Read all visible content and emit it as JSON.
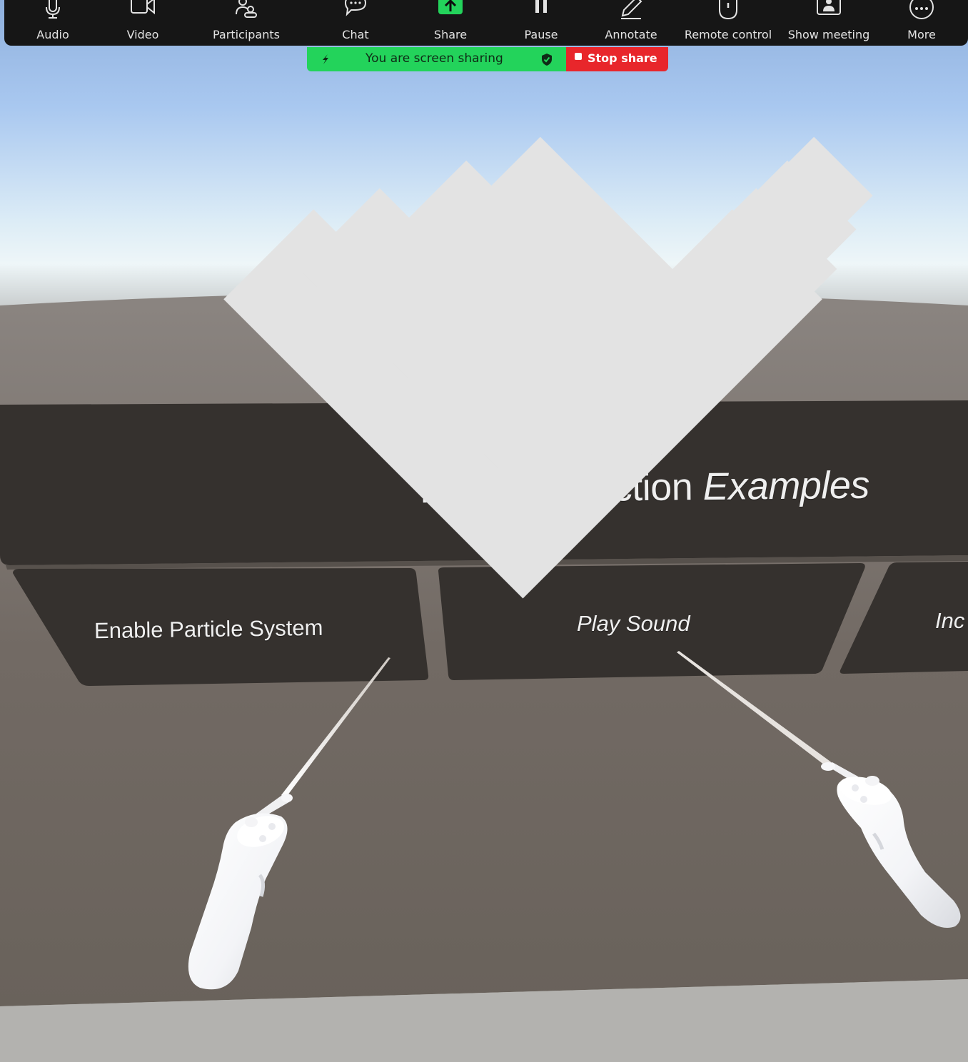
{
  "toolbar": {
    "audio_label": "Audio",
    "video_label": "Video",
    "participants_label": "Participants",
    "chat_label": "Chat",
    "share_label": "Share",
    "pause_label": "Pause",
    "annotate_label": "Annotate",
    "remote_control_label": "Remote control",
    "show_meeting_label": "Show meeting",
    "more_label": "More"
  },
  "share_banner": {
    "status_text": "You are screen sharing",
    "stop_label": "Stop share"
  },
  "vr_scene": {
    "panel_title_regular": "Poke Interaction ",
    "panel_title_italic": "Examples",
    "buttons": [
      {
        "label": "Enable Particle System"
      },
      {
        "label": "Play Sound"
      },
      {
        "label": "Inc"
      }
    ]
  },
  "colors": {
    "toolbar_bg": "#161616",
    "share_green": "#23d35b",
    "stop_red": "#e8262b",
    "panel_dark": "#35312e",
    "floor": "#69625b"
  }
}
